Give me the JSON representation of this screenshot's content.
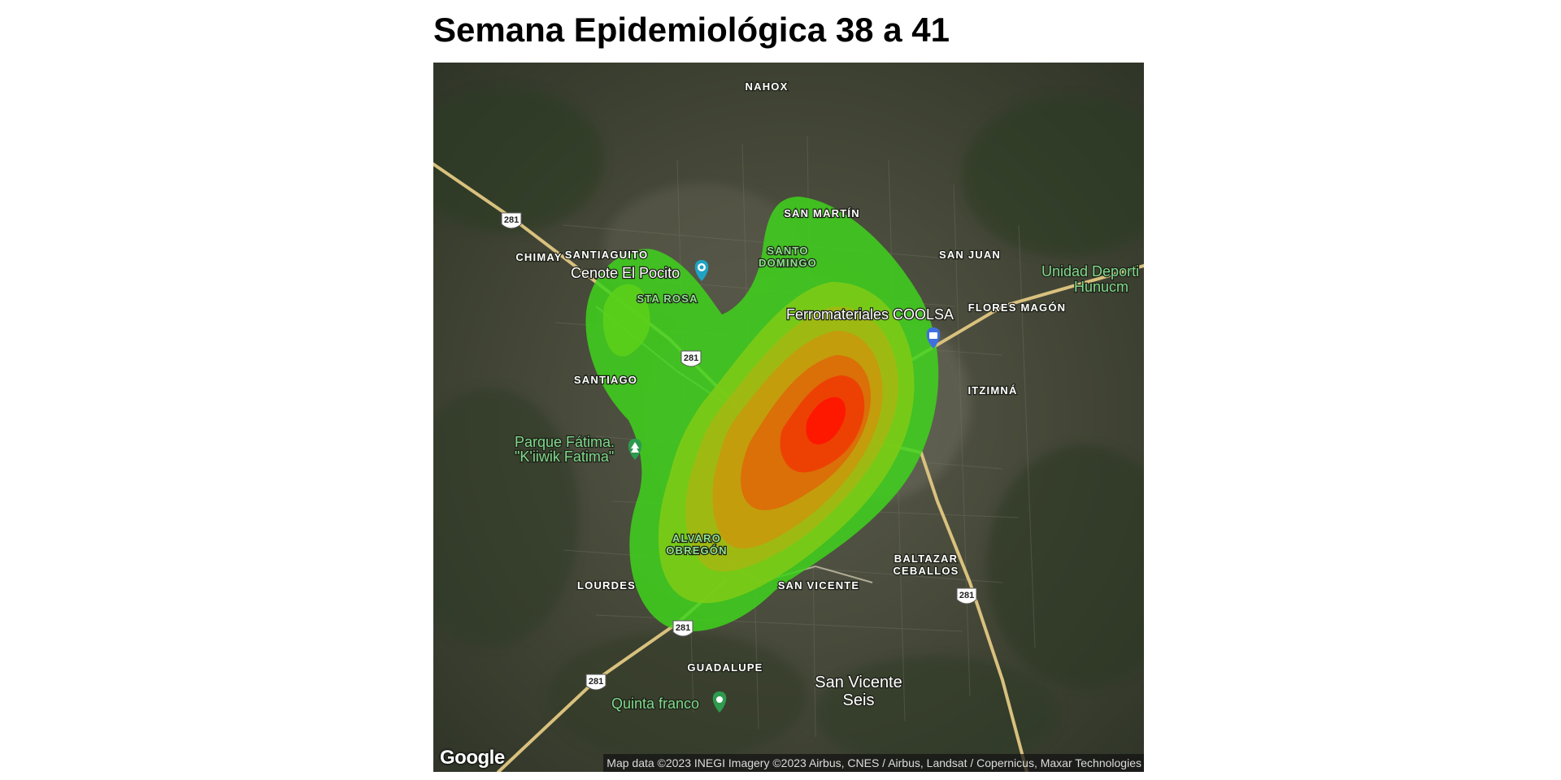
{
  "title": "Semana Epidemiológica 38 a 41",
  "map": {
    "labels": {
      "nahox": "NAHOX",
      "san_martin": "SAN MARTÍN",
      "chimay": "CHIMAY",
      "santiaguito": "SANTIAGUITO",
      "santo_domingo_1": "SANTO",
      "santo_domingo_2": "DOMINGO",
      "san_juan": "SAN JUAN",
      "flores_magon": "FLORES MAGÓN",
      "sta_rosa": "STA ROSA",
      "santiago": "SANTIAGO",
      "itzimna": "ITZIMNÁ",
      "alvaro_1": "ALVARO",
      "alvaro_2": "OBREGÓN",
      "baltazar_1": "BALTAZAR",
      "baltazar_2": "CEBALLOS",
      "lourdes": "LOURDES",
      "san_vicente": "SAN VICENTE",
      "guadalupe": "GUADALUPE"
    },
    "pois": {
      "cenote": "Cenote El Pocito",
      "ferro": "Ferromateriales COOLSA",
      "parque_1": "Parque Fátima.",
      "parque_2": "\"K'iiwik Fatima\"",
      "quinta": "Quinta franco",
      "unidad_1": "Unidad Deporti",
      "unidad_2": "Hunucm"
    },
    "places": {
      "san_vicente_seis_1": "San Vicente",
      "san_vicente_seis_2": "Seis"
    },
    "route_shield": "281",
    "attribution": "Map data ©2023 INEGI Imagery ©2023 Airbus, CNES / Airbus, Landsat / Copernicus, Maxar Technologies",
    "logo": "Google",
    "heatmap_colors": [
      "#3fd21c",
      "#5ccf1a",
      "#7ccb16",
      "#a3b812",
      "#c79a0c",
      "#de6a08",
      "#ee3c04",
      "#ff1400"
    ]
  }
}
